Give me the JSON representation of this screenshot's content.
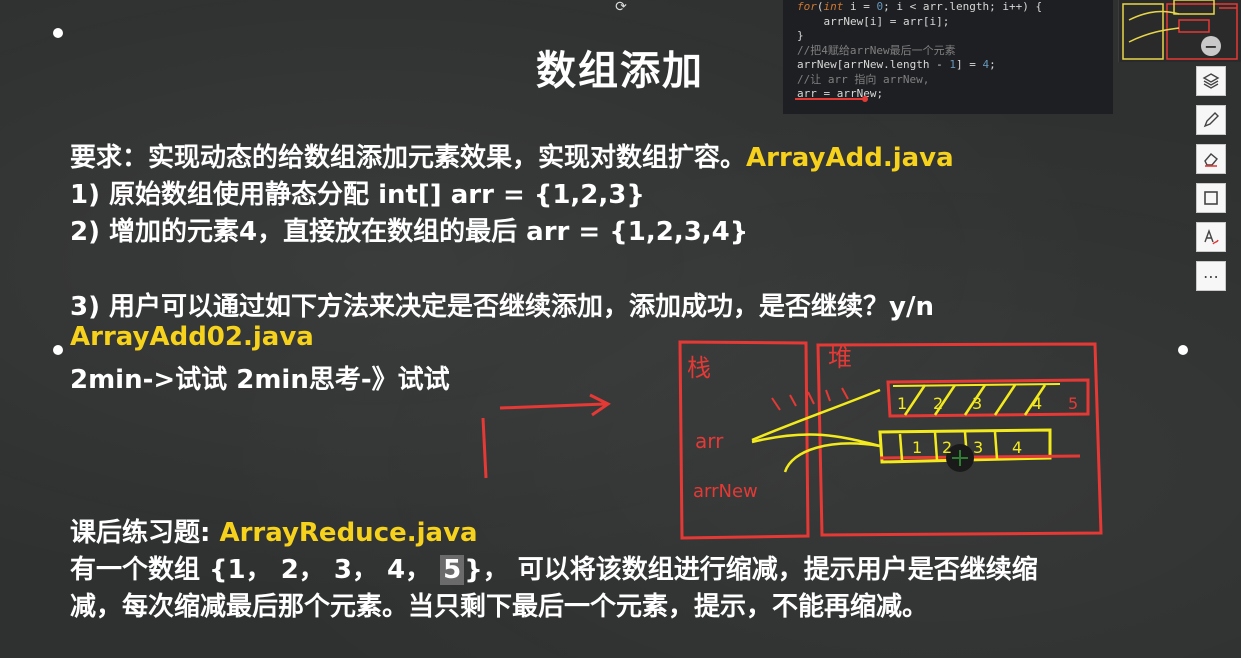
{
  "slide": {
    "title": "数组添加",
    "req_prefix": "要求：实现动态的给数组添加元素效果，实现对数组扩容。",
    "req_file": "ArrayAdd.java",
    "item1": "1) 原始数组使用静态分配 int[] arr = {1,2,3}",
    "item2": "2) 增加的元素4，直接放在数组的最后 arr = {1,2,3,4}",
    "item3": "3) 用户可以通过如下方法来决定是否继续添加，添加成功，是否继续？y/n",
    "item3_file": "ArrayAdd02.java",
    "try_line": "2min->试试 2min思考-》试试",
    "exercise_label": "课后练习题: ",
    "exercise_file": "ArrayReduce.java",
    "exercise_line1_a": "有一个数组 {1， 2， 3， 4， ",
    "exercise_line1_hl": "5",
    "exercise_line1_b": "}， 可以将该数组进行缩减，提示用户是否继续缩",
    "exercise_line2": "减，每次缩减最后那个元素。当只剩下最后一个元素，提示，不能再缩减。"
  },
  "code": {
    "l1_kw": "for",
    "l1_a": "(",
    "l1_int": "int",
    "l1_b": " i = ",
    "l1_zero": "0",
    "l1_c": "; i < arr.length; i++) {",
    "l2": "    arrNew[i] = arr[i];",
    "l3": "}",
    "l4": "//把4赋给arrNew最后一个元素",
    "l5_a": "arrNew[arrNew.length - ",
    "l5_one": "1",
    "l5_b": "] = ",
    "l5_four": "4",
    "l5_c": ";",
    "l6": "//让 arr 指向 arrNew,",
    "l7": "arr = arrNew;"
  },
  "sketch": {
    "stack_label": "栈",
    "heap_label": "堆",
    "arr_label": "arr",
    "arrnew_label": "arrNew",
    "old_array": [
      "1",
      "2",
      "3",
      "4",
      "5"
    ],
    "new_array": [
      "1",
      "2",
      "3",
      "4"
    ]
  },
  "toolbar": {
    "minus_icon": "minus-icon",
    "tools": [
      "layers-icon",
      "pen-icon",
      "eraser-icon",
      "frame-icon",
      "text-pen-icon",
      "more-icon"
    ],
    "more_label": "⋯"
  },
  "colors": {
    "accent_yellow": "#f6d21d",
    "sketch_red": "#e53935",
    "sketch_yellow": "#f2ea1c"
  }
}
